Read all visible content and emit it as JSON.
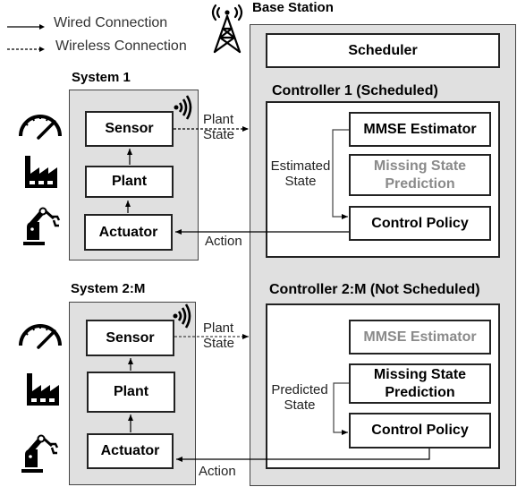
{
  "legend": {
    "wired": "Wired Connection",
    "wireless": "Wireless Connection"
  },
  "base_station": {
    "title": "Base Station",
    "icon": "cell-tower-icon",
    "scheduler": "Scheduler",
    "controllers": [
      {
        "title": "Controller 1 (Scheduled)",
        "mmse": "MMSE Estimator",
        "missing_line1": "Missing State",
        "missing_line2": "Prediction",
        "policy": "Control Policy",
        "side_label_line1": "Estimated",
        "side_label_line2": "State",
        "active_block": "mmse"
      },
      {
        "title": "Controller 2:M (Not Scheduled)",
        "mmse": "MMSE Estimator",
        "missing_line1": "Missing State",
        "missing_line2": "Prediction",
        "policy": "Control Policy",
        "side_label_line1": "Predicted",
        "side_label_line2": "State",
        "active_block": "missing"
      }
    ]
  },
  "systems": [
    {
      "title": "System 1",
      "sensor": "Sensor",
      "plant": "Plant",
      "actuator": "Actuator",
      "uplink_line1": "Plant",
      "uplink_line2": "State",
      "downlink": "Action"
    },
    {
      "title": "System 2:M",
      "sensor": "Sensor",
      "plant": "Plant",
      "actuator": "Actuator",
      "uplink_line1": "Plant",
      "uplink_line2": "State",
      "downlink": "Action"
    }
  ],
  "icons": [
    "gauge-icon",
    "factory-icon",
    "robot-arm-icon",
    "wireless-signal-icon",
    "cell-tower-icon"
  ],
  "colors": {
    "container_fill": "#e0e0e0",
    "inactive_text": "#8a8a8a"
  }
}
